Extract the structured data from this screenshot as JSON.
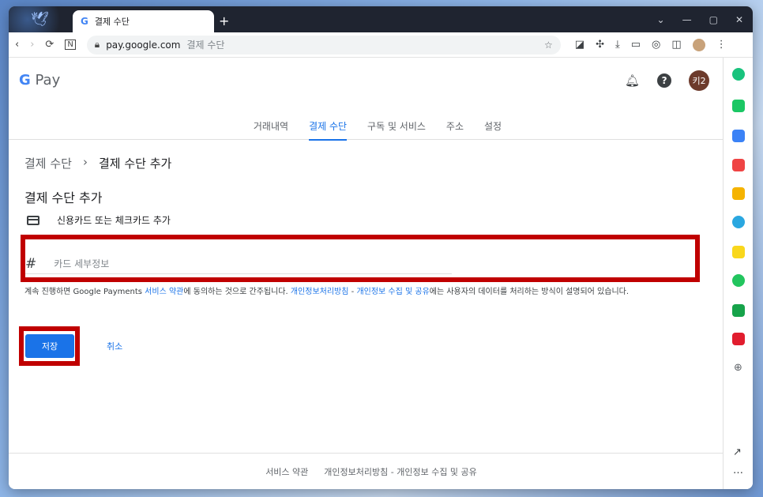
{
  "tab": {
    "title": "결제 수단",
    "favicon": "G"
  },
  "new_tab_label": "+",
  "window_controls": {
    "chevron": "⌄",
    "minimize": "—",
    "maximize": "▢",
    "close": "✕"
  },
  "address": {
    "domain": "pay.google.com",
    "path": "결제 수단"
  },
  "header": {
    "logo_g": "G",
    "logo_pay": "Pay",
    "user_initials": "키2"
  },
  "nav": {
    "items": [
      "거래내역",
      "결제 수단",
      "구독 및 서비스",
      "주소",
      "설정"
    ],
    "active_index": 1
  },
  "breadcrumb": {
    "parent": "결제 수단",
    "separator": "›",
    "current": "결제 수단 추가"
  },
  "section": {
    "title": "결제 수단 추가",
    "card_type_label": "신용카드 또는 체크카드 추가"
  },
  "card_input": {
    "placeholder": "카드 세부정보",
    "value": ""
  },
  "terms": {
    "prefix": "계속 진행하면 Google Payments ",
    "link1": "서비스 약관",
    "middle1": "에 동의하는 것으로 간주됩니다. ",
    "link2": "개인정보처리방침",
    "sep": " - ",
    "link3": "개인정보 수집 및 공유",
    "suffix": "에는 사용자의 데이터를 처리하는 방식이 설명되어 있습니다."
  },
  "actions": {
    "save": "저장",
    "cancel": "취소"
  },
  "footer": {
    "terms": "서비스 약관",
    "privacy": "개인정보처리방침 - 개인정보 수집 및 공유"
  },
  "colors": {
    "accent": "#1a73e8",
    "highlight": "#c00000",
    "avatar": "#6d3b2c"
  }
}
